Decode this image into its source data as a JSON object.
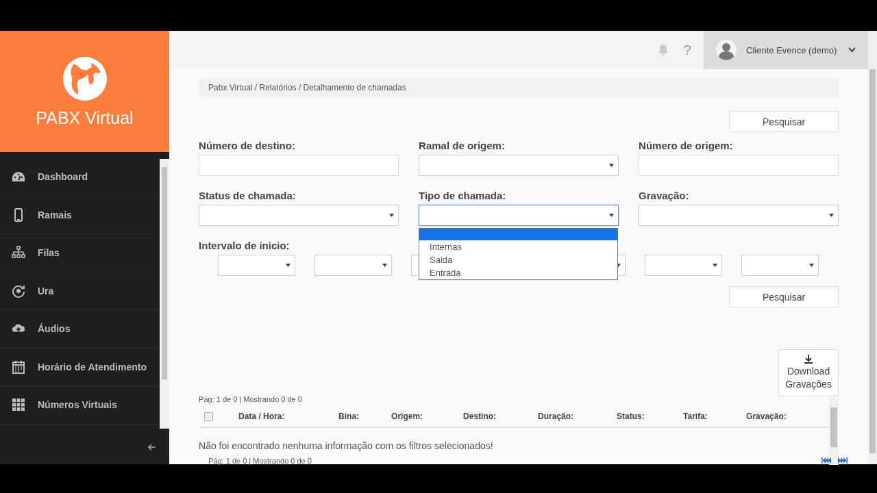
{
  "logo": {
    "title": "PABX Virtual"
  },
  "sidebar": {
    "items": [
      {
        "label": "Dashboard"
      },
      {
        "label": "Ramais"
      },
      {
        "label": "Filas"
      },
      {
        "label": "Ura"
      },
      {
        "label": "Áudios"
      },
      {
        "label": "Horário de Atendimento"
      },
      {
        "label": "Números Virtuais"
      }
    ]
  },
  "topbar": {
    "help": "?",
    "user": "Cliente Evence (demo)"
  },
  "breadcrumb": "Pabx Virtual / Relatórios / Detalhamento de chamadas",
  "search_button_top": "Pesquisar",
  "filters": [
    {
      "label": "Número de destino:",
      "kind": "text"
    },
    {
      "label": "Ramal de origem:",
      "kind": "select"
    },
    {
      "label": "Número de origem:",
      "kind": "text"
    },
    {
      "label": "Status de chamada:",
      "kind": "select"
    },
    {
      "label": "Tipo de chamada:",
      "kind": "select",
      "expanded": true,
      "options": [
        {
          "selected": true
        },
        {
          "label": "Internas",
          "selected": false
        },
        {
          "label": "Saida",
          "selected": false
        },
        {
          "label": "Entrada",
          "selected": false
        }
      ]
    },
    {
      "label": "Gravação:",
      "kind": "select"
    }
  ],
  "interval": {
    "label": "Intervalo de inicio:"
  },
  "search_button": "Pesquisar",
  "download_button": "Download Gravações",
  "table": {
    "pagination_top": "Pág: 1 de 0 | Mostrando 0 de 0",
    "select_all_checked": false,
    "columns": [
      "Data / Hora:",
      "Bina:",
      "Origem:",
      "Destino:",
      "Duração:",
      "Status:",
      "Tarifa:",
      "Gravação:"
    ],
    "empty_message": "Não foi encontrado nenhuma informação com os filtros selecionados!",
    "pagination_bottom": "Pág: 1 de 0 | Mostrando 0 de 0"
  }
}
